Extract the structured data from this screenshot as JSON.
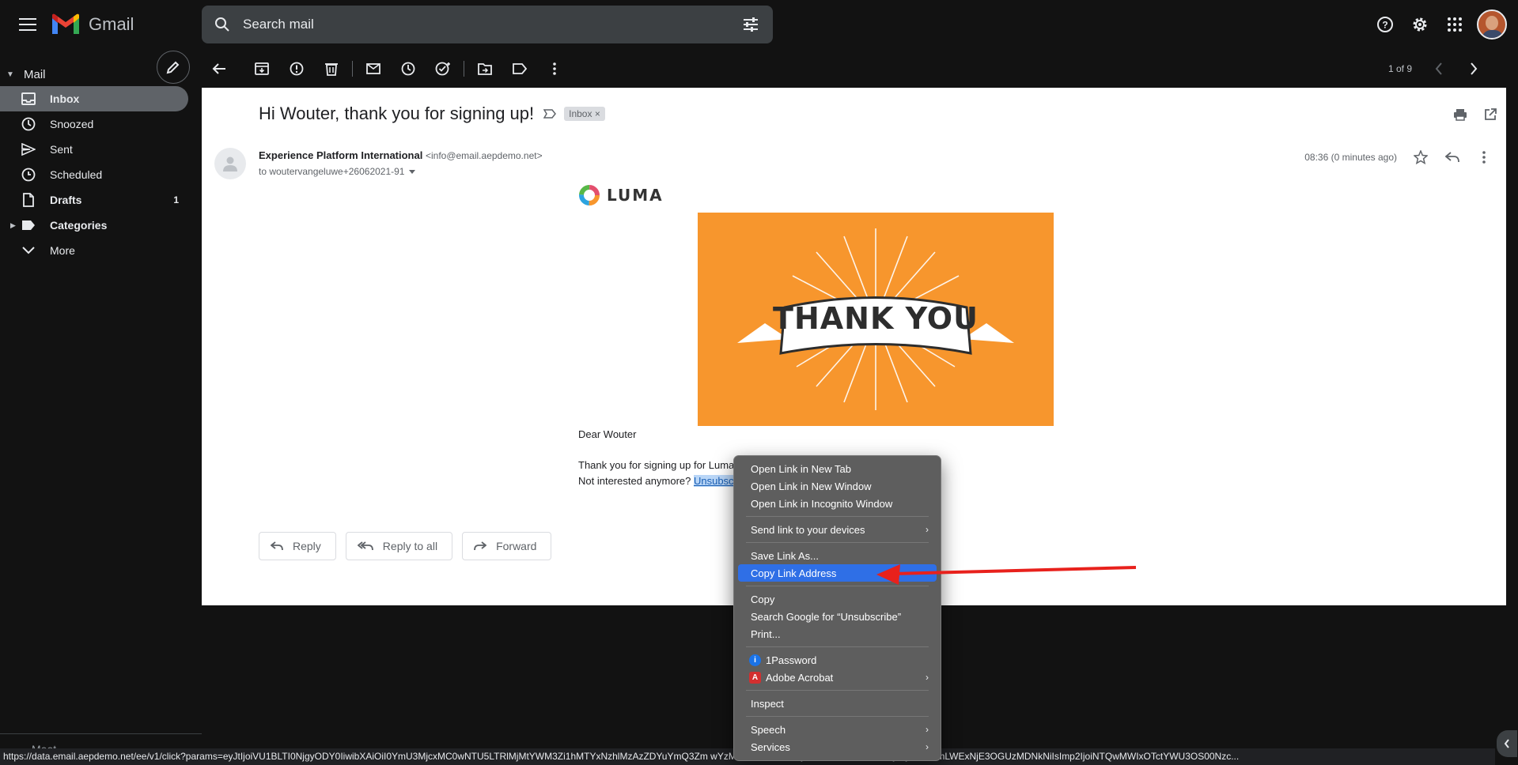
{
  "app": {
    "name": "Gmail"
  },
  "search": {
    "placeholder": "Search mail"
  },
  "sidebar": {
    "section_label": "Mail",
    "items": [
      {
        "label": "Inbox",
        "count": ""
      },
      {
        "label": "Snoozed",
        "count": ""
      },
      {
        "label": "Sent",
        "count": ""
      },
      {
        "label": "Scheduled",
        "count": ""
      },
      {
        "label": "Drafts",
        "count": "1"
      },
      {
        "label": "Categories",
        "count": ""
      },
      {
        "label": "More",
        "count": ""
      }
    ],
    "meet_label": "Meet"
  },
  "toolbar": {
    "pager": "1 of 9"
  },
  "message": {
    "subject": "Hi Wouter, thank you for signing up!",
    "label_chip": "Inbox",
    "sender_name": "Experience Platform International",
    "sender_email": "<info@email.aepdemo.net>",
    "recipient": "to woutervangeluwe+26062021-91",
    "time": "08:36 (0 minutes ago)",
    "brand": "LUMA",
    "banner_text": "THANK YOU",
    "greeting": "Dear Wouter",
    "line1": "Thank you for signing up for Luma",
    "line2_prefix": "Not interested anymore? ",
    "unsubscribe_visible": "Unsubsc"
  },
  "actions": {
    "reply": "Reply",
    "reply_all": "Reply to all",
    "forward": "Forward"
  },
  "context_menu": {
    "items": [
      "Open Link in New Tab",
      "Open Link in New Window",
      "Open Link in Incognito Window",
      "Send link to your devices",
      "Save Link As...",
      "Copy Link Address",
      "Copy",
      "Search Google for “Unsubscribe”",
      "Print...",
      "1Password",
      "Adobe Acrobat",
      "Inspect",
      "Speech",
      "Services"
    ],
    "highlighted": "Copy Link Address"
  },
  "status_url": "https://data.email.aepdemo.net/ee/v1/click?params=eyJtIjoiVU1BLTI0NjgyODY0IiwibXAiOiI0YmU3MjcxMC0wNTU5LTRlMjMtYWM3Zi1hMTYxNzhlMzAzZDYuYmQ3Zm                                                                                     wYzM4ZTEzLDRiZTcyNzEwLTA1NTktNGUyMy1hYzdmLWExNjE3OGUzMDNkNiIsImp2IjoiNTQwMWIxOTctYWU3OS00Nzc...",
  "colors": {
    "accent": "#2f6fe6",
    "banner": "#f7962d",
    "arrow": "#e8211c"
  }
}
